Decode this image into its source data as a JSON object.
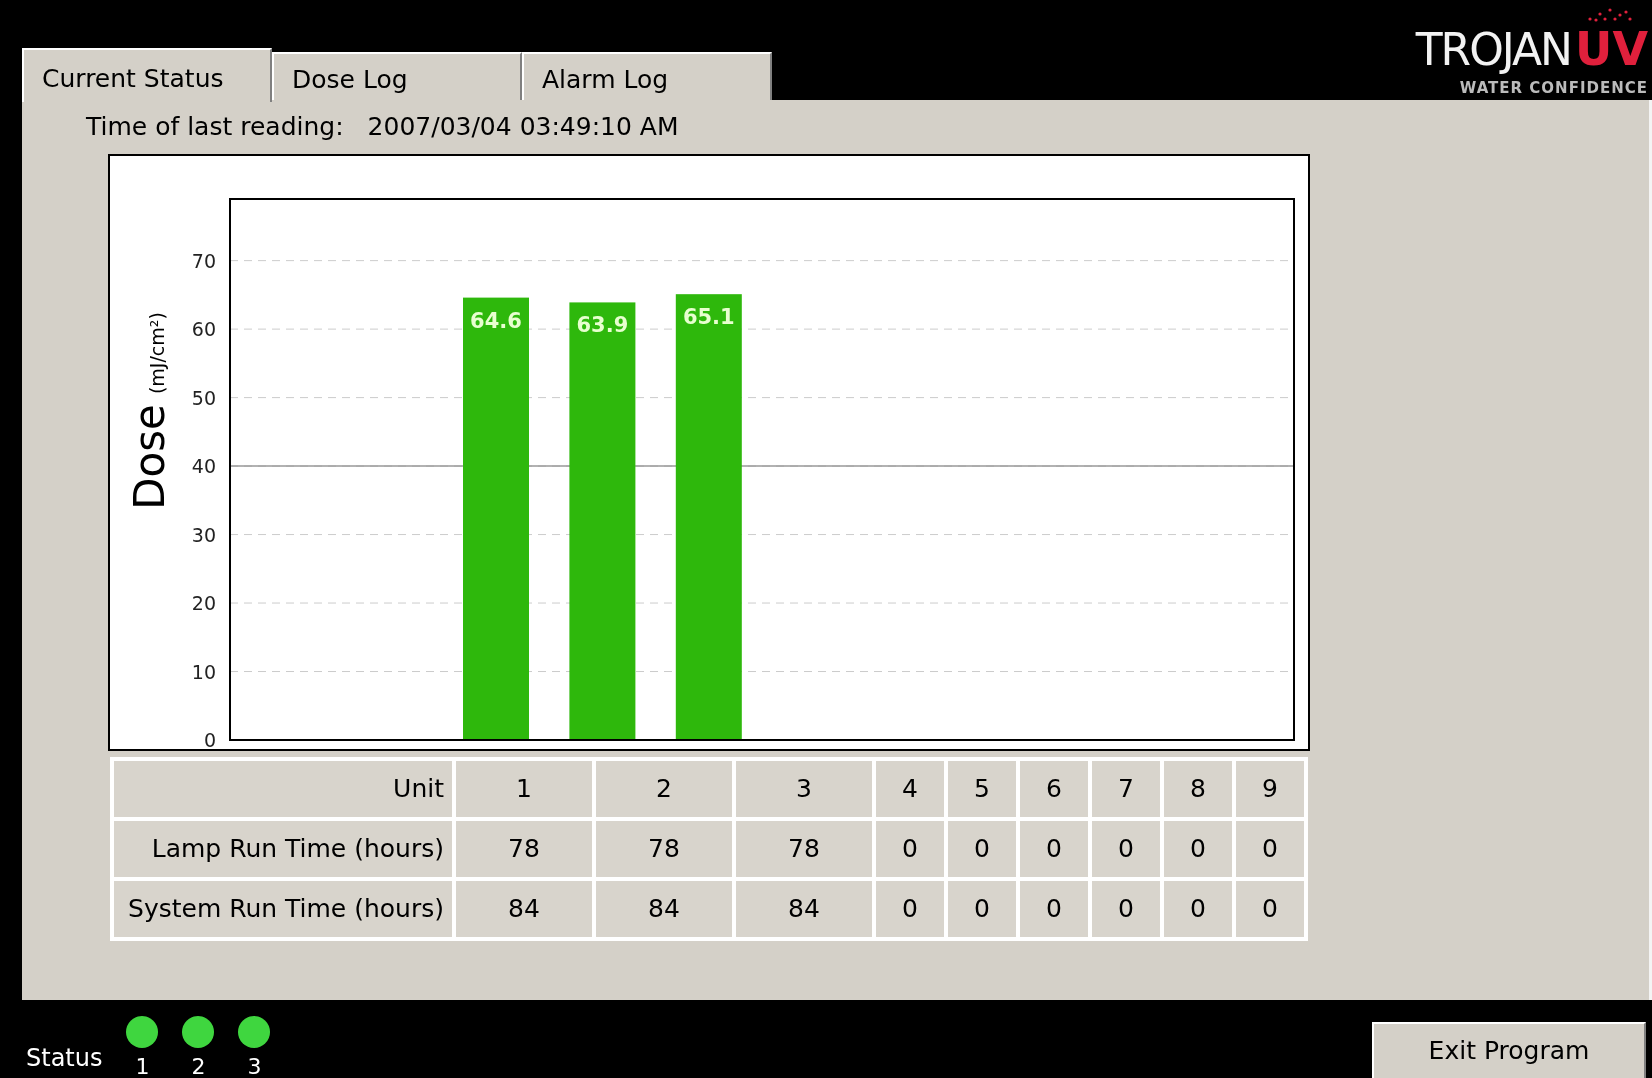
{
  "tabs": [
    {
      "label": "Current Status",
      "selected": true
    },
    {
      "label": "Dose Log",
      "selected": false
    },
    {
      "label": "Alarm Log",
      "selected": false
    }
  ],
  "logo": {
    "name": "TROJAN",
    "mark": "UV",
    "tagline": "WATER CONFIDENCE"
  },
  "last_reading": {
    "label": "Time of last reading:",
    "value": "2007/03/04 03:49:10 AM"
  },
  "chart_data": {
    "type": "bar",
    "ylabel": "Dose (mJ/cm²)",
    "values": [
      null,
      null,
      64.6,
      63.9,
      65.1,
      null,
      null,
      null,
      null,
      null
    ],
    "value_labels": [
      null,
      null,
      "64.6",
      "63.9",
      "65.1",
      null,
      null,
      null,
      null,
      null
    ],
    "ylim": [
      0,
      79
    ],
    "yticks": [
      0,
      10,
      20,
      30,
      40,
      50,
      60,
      70
    ],
    "grid": true,
    "ref_lines": [
      {
        "axis": "y",
        "value": 40
      }
    ]
  },
  "table": {
    "columns": [
      "Unit",
      "1",
      "2",
      "3",
      "4",
      "5",
      "6",
      "7",
      "8",
      "9"
    ],
    "rows": [
      [
        "Lamp Run Time (hours)",
        "78",
        "78",
        "78",
        "0",
        "0",
        "0",
        "0",
        "0",
        "0"
      ],
      [
        "System Run Time (hours)",
        "84",
        "84",
        "84",
        "0",
        "0",
        "0",
        "0",
        "0",
        "0"
      ]
    ]
  },
  "status": {
    "label": "Status",
    "units": [
      {
        "label": "1",
        "color": "#3fd63f"
      },
      {
        "label": "2",
        "color": "#3fd63f"
      },
      {
        "label": "3",
        "color": "#3fd63f"
      }
    ]
  },
  "buttons": [
    {
      "label": "Exit Program"
    }
  ]
}
